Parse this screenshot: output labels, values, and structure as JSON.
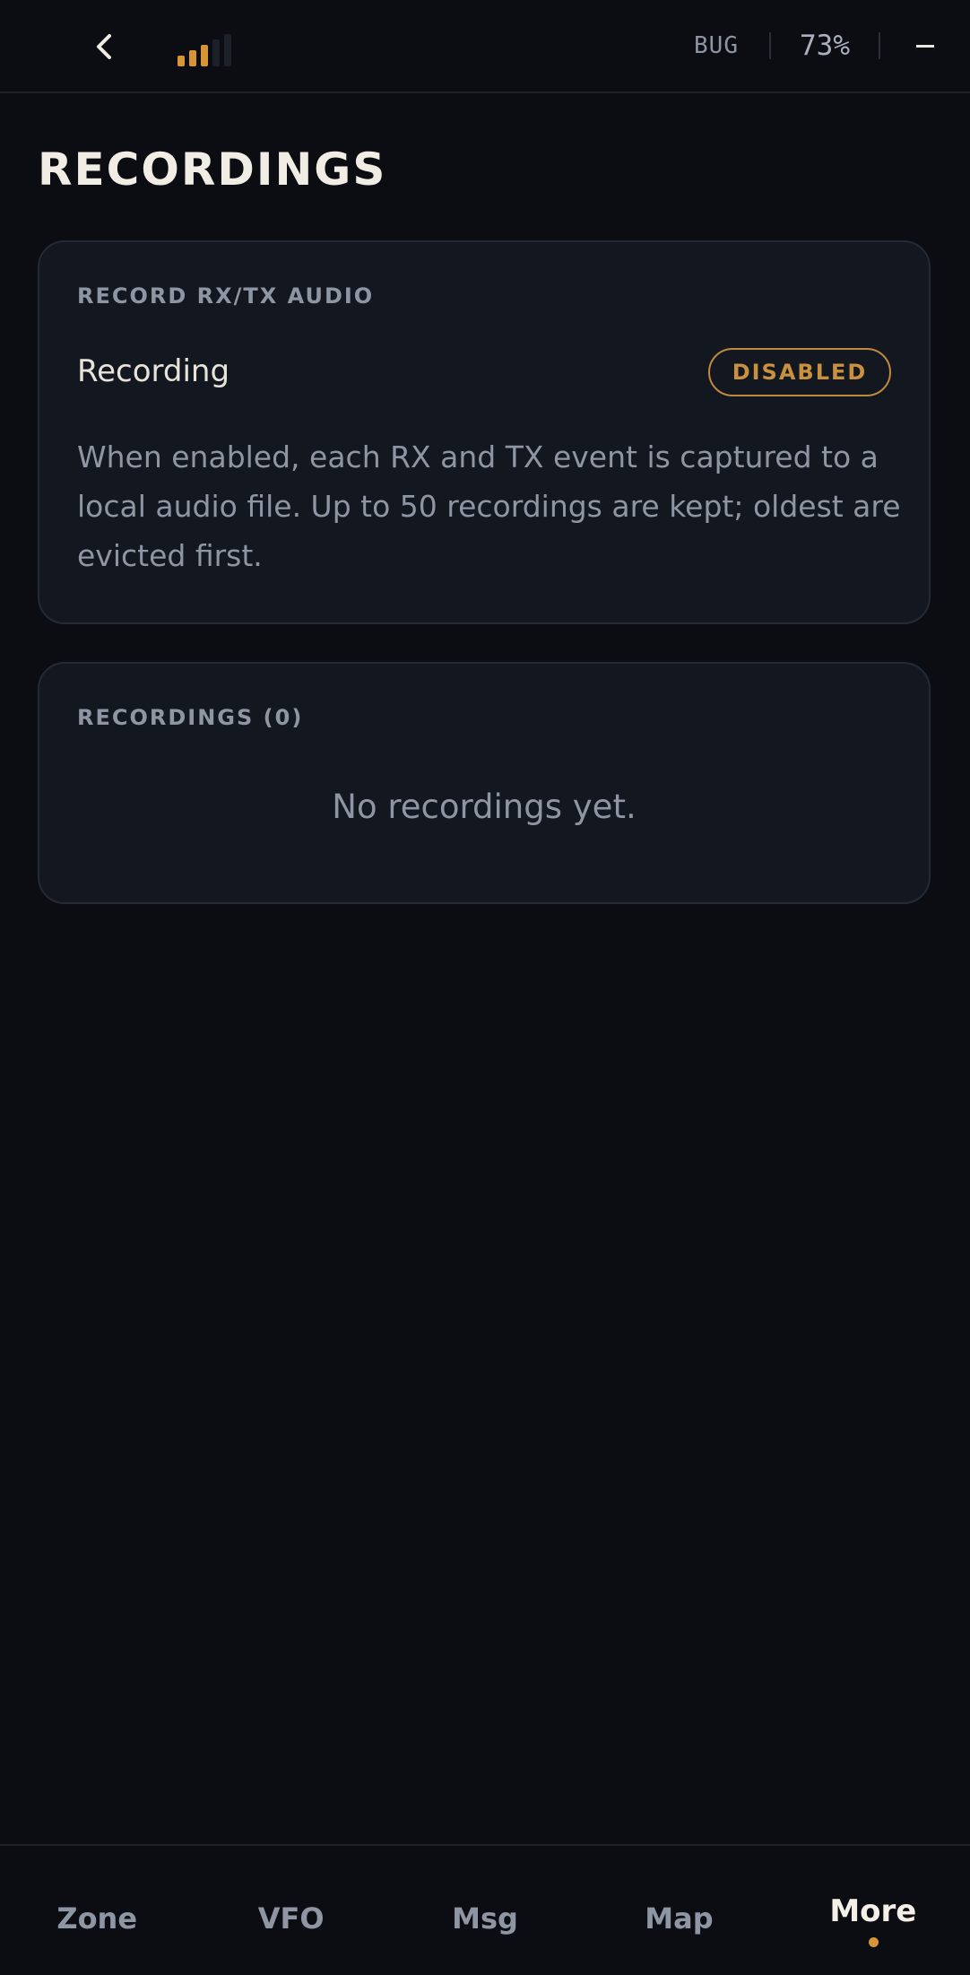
{
  "topbar": {
    "connection_label": "BUG",
    "battery_text": "73%",
    "signal_bars_total": 5,
    "signal_bars_active": 3,
    "signal_color": "#d89535",
    "icons": {
      "back": "chevron-left-icon",
      "signal": "signal-strength-icon",
      "minimize": "minimize-icon"
    }
  },
  "page": {
    "title": "RECORDINGS"
  },
  "record_card": {
    "section_label": "RECORD RX/TX AUDIO",
    "setting_label": "Recording",
    "status_badge": "DISABLED",
    "description": "When enabled, each RX and TX event is captured to a local audio file. Up to 50 recordings are kept; oldest are evicted first."
  },
  "recordings_card": {
    "section_label": "RECORDINGS (0)",
    "empty_text": "No recordings yet."
  },
  "bottom_nav": {
    "items": [
      {
        "label": "Zone"
      },
      {
        "label": "VFO"
      },
      {
        "label": "Msg"
      },
      {
        "label": "Map"
      },
      {
        "label": "More"
      }
    ],
    "active_index": 4,
    "accent_color": "#d89535"
  }
}
